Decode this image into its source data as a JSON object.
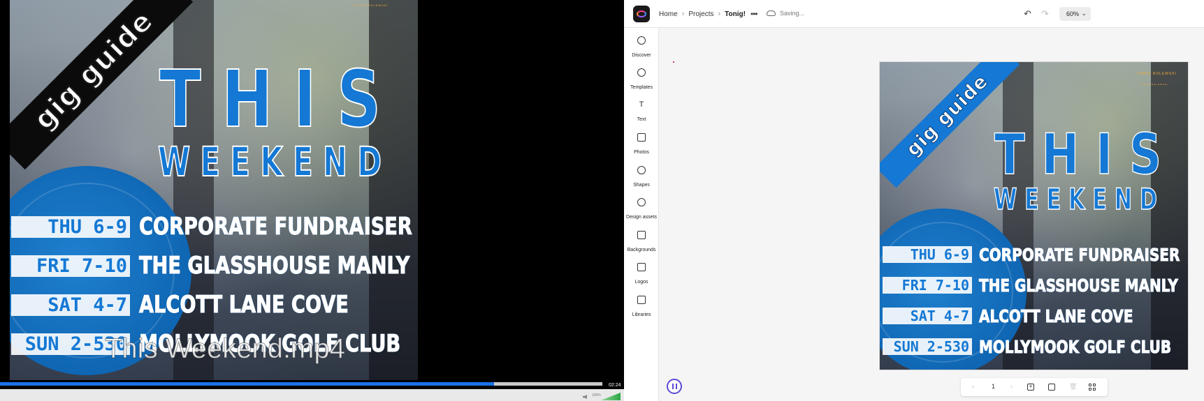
{
  "player": {
    "subtitle": "This Weekend.mp4",
    "elapsed": "02:24",
    "progress": 0.82,
    "volume_label": "100%"
  },
  "poster": {
    "banner": "gig guide",
    "title": "THIS",
    "subtitle": "WEEKEND",
    "credit_name": "CHRIS RULEWSKI",
    "credit_sub": "#CHRISRULEWSKI",
    "gigs": [
      {
        "day": "THU 6-9",
        "venue": "CORPORATE FUNDRAISER"
      },
      {
        "day": "FRI 7-10",
        "venue": "THE GLASSHOUSE MANLY"
      },
      {
        "day": "SAT 4-7",
        "venue": "ALCOTT LANE COVE"
      },
      {
        "day": "SUN 2-530",
        "venue": "MOLLYMOOK GOLF CLUB"
      }
    ]
  },
  "editor": {
    "breadcrumb": [
      "Home",
      "Projects",
      "Tonig!"
    ],
    "saving": "Saving...",
    "zoom": "60%",
    "rail": [
      {
        "label": "Discover",
        "icon": "discover-icon"
      },
      {
        "label": "Templates",
        "icon": "templates-icon"
      },
      {
        "label": "Text",
        "icon": "text-icon"
      },
      {
        "label": "Photos",
        "icon": "photos-icon"
      },
      {
        "label": "Shapes",
        "icon": "shapes-icon"
      },
      {
        "label": "Design assets",
        "icon": "design-assets-icon"
      },
      {
        "label": "Backgrounds",
        "icon": "backgrounds-icon"
      },
      {
        "label": "Logos",
        "icon": "logos-icon"
      },
      {
        "label": "Libraries",
        "icon": "libraries-icon"
      }
    ],
    "page_number": "1"
  },
  "colors": {
    "accent_blue": "#1478d4",
    "progress_blue": "#1a73e8",
    "banner_black": "#0b0b0b",
    "play_purple": "#5b4bd6",
    "credit_orange": "#f2a93b"
  }
}
